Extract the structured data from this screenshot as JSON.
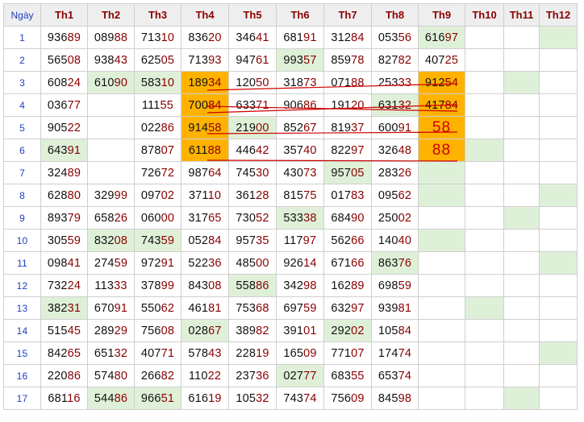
{
  "header": {
    "day": "Ngày",
    "cols": [
      "Th1",
      "Th2",
      "Th3",
      "Th4",
      "Th5",
      "Th6",
      "Th7",
      "Th8",
      "Th9",
      "Th10",
      "Th11",
      "Th12"
    ]
  },
  "rows": [
    {
      "day": "1",
      "cells": [
        "93689",
        "08988",
        "71310",
        "83620",
        "34641",
        "68191",
        "31284",
        "05356",
        "61697",
        "",
        "",
        ""
      ]
    },
    {
      "day": "2",
      "cells": [
        "56508",
        "93843",
        "62505",
        "71393",
        "94761",
        "99357",
        "85978",
        "82782",
        "40725",
        "",
        "",
        ""
      ]
    },
    {
      "day": "3",
      "cells": [
        "60824",
        "61090",
        "58310",
        "18934",
        "12050",
        "31873",
        "07188",
        "25333",
        "91254",
        "",
        "",
        ""
      ]
    },
    {
      "day": "4",
      "cells": [
        "03677",
        "",
        "11155",
        "70084",
        "63371",
        "90686",
        "19120",
        "63132",
        "41784",
        "",
        "",
        ""
      ]
    },
    {
      "day": "5",
      "cells": [
        "90522",
        "",
        "02286",
        "91458",
        "21900",
        "85267",
        "81937",
        "60091",
        "58",
        "",
        "",
        ""
      ]
    },
    {
      "day": "6",
      "cells": [
        "64391",
        "",
        "87807",
        "61188",
        "44642",
        "35740",
        "82297",
        "32648",
        "88",
        "",
        "",
        ""
      ]
    },
    {
      "day": "7",
      "cells": [
        "32489",
        "",
        "72672",
        "98764",
        "74530",
        "43073",
        "95705",
        "28326",
        "",
        "",
        "",
        ""
      ]
    },
    {
      "day": "8",
      "cells": [
        "62880",
        "32999",
        "09702",
        "37110",
        "36128",
        "81575",
        "01783",
        "09562",
        "",
        "",
        "",
        ""
      ]
    },
    {
      "day": "9",
      "cells": [
        "89379",
        "65826",
        "06000",
        "31765",
        "73052",
        "53338",
        "68490",
        "25002",
        "",
        "",
        "",
        ""
      ]
    },
    {
      "day": "10",
      "cells": [
        "30559",
        "83208",
        "74359",
        "05284",
        "95735",
        "11797",
        "56266",
        "14040",
        "",
        "",
        "",
        ""
      ]
    },
    {
      "day": "11",
      "cells": [
        "09841",
        "27459",
        "97291",
        "52236",
        "48500",
        "92614",
        "67166",
        "86376",
        "",
        "",
        "",
        ""
      ]
    },
    {
      "day": "12",
      "cells": [
        "73224",
        "11333",
        "37899",
        "84308",
        "55886",
        "34298",
        "16289",
        "69859",
        "",
        "",
        "",
        ""
      ]
    },
    {
      "day": "13",
      "cells": [
        "38231",
        "67091",
        "55062",
        "46181",
        "75368",
        "69759",
        "63297",
        "93981",
        "",
        "",
        "",
        ""
      ]
    },
    {
      "day": "14",
      "cells": [
        "51545",
        "28929",
        "75608",
        "02867",
        "38982",
        "39101",
        "29202",
        "10584",
        "",
        "",
        "",
        ""
      ]
    },
    {
      "day": "15",
      "cells": [
        "84265",
        "65132",
        "40771",
        "57843",
        "22819",
        "16509",
        "77107",
        "17474",
        "",
        "",
        "",
        ""
      ]
    },
    {
      "day": "16",
      "cells": [
        "22086",
        "57480",
        "26682",
        "11022",
        "23736",
        "02777",
        "68355",
        "65374",
        "",
        "",
        "",
        ""
      ]
    },
    {
      "day": "17",
      "cells": [
        "68116",
        "54486",
        "96651",
        "61619",
        "10532",
        "74374",
        "75609",
        "84598",
        "",
        "",
        "",
        ""
      ]
    }
  ],
  "colors": {
    "green": "#dff0d8",
    "orange": "#ffb300",
    "header_text": "#8b0000",
    "day_text": "#1f3fbf",
    "line": "#cc0000"
  },
  "highlights": {
    "green": [
      [
        0,
        8
      ],
      [
        0,
        11
      ],
      [
        1,
        5
      ],
      [
        2,
        1
      ],
      [
        2,
        2
      ],
      [
        2,
        10
      ],
      [
        3,
        7
      ],
      [
        4,
        4
      ],
      [
        5,
        0
      ],
      [
        5,
        9
      ],
      [
        6,
        6
      ],
      [
        6,
        8
      ],
      [
        7,
        8
      ],
      [
        7,
        11
      ],
      [
        8,
        5
      ],
      [
        8,
        10
      ],
      [
        9,
        1
      ],
      [
        9,
        2
      ],
      [
        9,
        8
      ],
      [
        10,
        7
      ],
      [
        10,
        11
      ],
      [
        11,
        4
      ],
      [
        12,
        0
      ],
      [
        12,
        9
      ],
      [
        13,
        3
      ],
      [
        13,
        6
      ],
      [
        14,
        11
      ],
      [
        15,
        5
      ],
      [
        16,
        1
      ],
      [
        16,
        2
      ],
      [
        16,
        10
      ]
    ],
    "orange": [
      [
        2,
        3
      ],
      [
        3,
        3
      ],
      [
        4,
        3
      ],
      [
        5,
        3
      ],
      [
        2,
        8
      ],
      [
        3,
        8
      ],
      [
        4,
        8
      ],
      [
        5,
        8
      ]
    ]
  }
}
